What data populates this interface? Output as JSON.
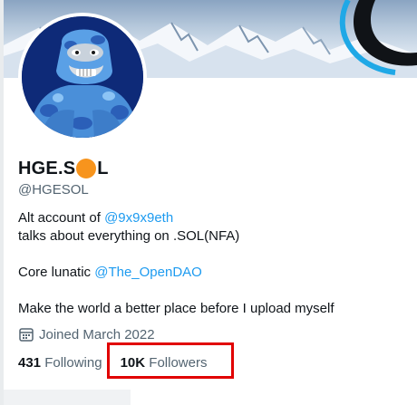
{
  "profile": {
    "name_part1": "HGE.S",
    "name_part2": "L",
    "handle": "@HGESOL",
    "bio": {
      "line1_prefix": "Alt account of ",
      "line1_link": "@9x9x9eth",
      "line2": "talks about everything on .SOL(NFA)",
      "line3_prefix": "Core lunatic ",
      "line3_link": "@The_OpenDAO",
      "line4": "Make the world a better place before I upload myself"
    },
    "joined": "Joined March 2022",
    "joined_icon": "calendar-icon",
    "stats": {
      "following_count": "431",
      "following_label": "Following",
      "followers_count": "10K",
      "followers_label": "Followers"
    }
  },
  "colors": {
    "link": "#1d9bf0",
    "muted_text": "#536471",
    "text": "#0f1419",
    "name_emoji": "#f7941d",
    "highlight_box": "#e10000",
    "avatar_bg": "#0e2a78"
  }
}
